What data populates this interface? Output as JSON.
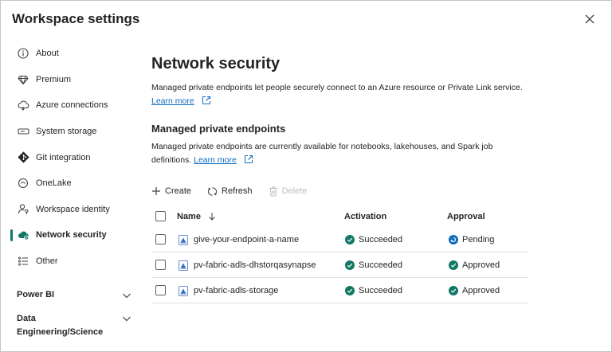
{
  "dialog": {
    "title": "Workspace settings"
  },
  "sidebar": {
    "items": [
      {
        "label": "About",
        "icon": "info-icon"
      },
      {
        "label": "Premium",
        "icon": "diamond-icon"
      },
      {
        "label": "Azure connections",
        "icon": "cloud-icon"
      },
      {
        "label": "System storage",
        "icon": "storage-icon"
      },
      {
        "label": "Git integration",
        "icon": "git-icon"
      },
      {
        "label": "OneLake",
        "icon": "onelake-icon"
      },
      {
        "label": "Workspace identity",
        "icon": "identity-icon"
      },
      {
        "label": "Network security",
        "icon": "network-cloud-icon",
        "active": true
      },
      {
        "label": "Other",
        "icon": "list-icon"
      }
    ],
    "groups": [
      {
        "label": "Power BI"
      },
      {
        "label": "Data Engineering/Science"
      }
    ]
  },
  "main": {
    "title": "Network security",
    "description": "Managed private endpoints let people securely connect to an Azure resource or Private Link service.",
    "learn_more": "Learn more",
    "section_title": "Managed private endpoints",
    "section_description": "Managed private endpoints are currently available for notebooks, lakehouses, and Spark job definitions.",
    "section_learn_more": "Learn more"
  },
  "toolbar": {
    "create_label": "Create",
    "refresh_label": "Refresh",
    "delete_label": "Delete"
  },
  "table": {
    "columns": {
      "name": "Name",
      "activation": "Activation",
      "approval": "Approval"
    },
    "rows": [
      {
        "name": "give-your-endpoint-a-name",
        "activation": "Succeeded",
        "approval": "Pending",
        "approval_status": "pending"
      },
      {
        "name": "pv-fabric-adls-dhstorqasynapse",
        "activation": "Succeeded",
        "approval": "Approved",
        "approval_status": "approved"
      },
      {
        "name": "pv-fabric-adls-storage",
        "activation": "Succeeded",
        "approval": "Approved",
        "approval_status": "approved"
      }
    ]
  },
  "colors": {
    "accent": "#117865",
    "success": "#107c41",
    "pending": "#0f6cbd",
    "link": "#0f6cbd"
  }
}
